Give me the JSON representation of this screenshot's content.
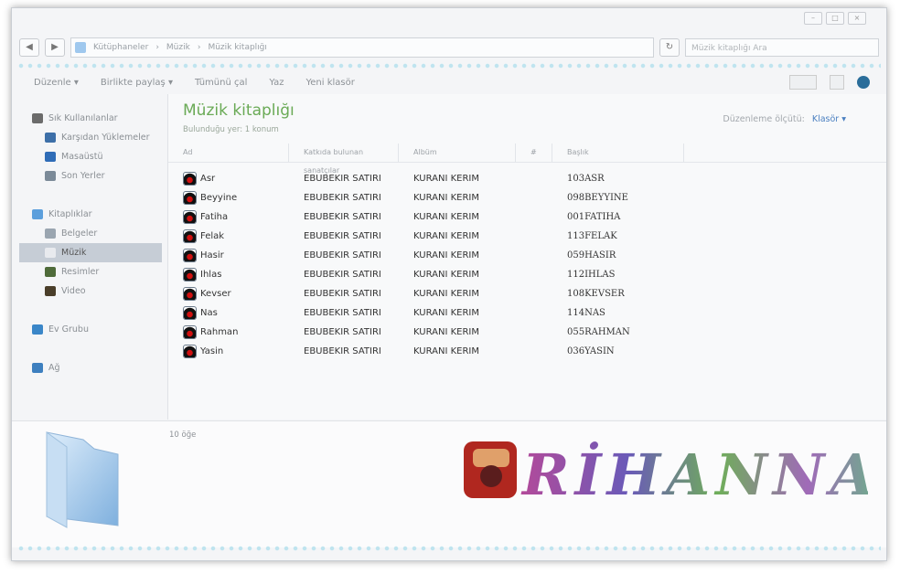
{
  "window": {
    "buttons": [
      "–",
      "□",
      "×"
    ]
  },
  "address": {
    "path": [
      "Kütüphaneler",
      "Müzik",
      "Müzik kitaplığı"
    ],
    "search_placeholder": "Müzik kitaplığı Ara"
  },
  "toolbar": {
    "items": [
      "Düzenle ▾",
      "Birlikte paylaş ▾",
      "Tümünü çal",
      "Yaz",
      "Yeni klasör"
    ]
  },
  "sidebar": {
    "favorites_label": "Sık Kullanılanlar",
    "favorites": [
      "Karşıdan Yüklemeler",
      "Masaüstü",
      "Son Yerler"
    ],
    "libraries_label": "Kitaplıklar",
    "libraries": [
      "Belgeler",
      "Müzik",
      "Resimler",
      "Video"
    ],
    "selected": "Müzik",
    "homegroup": "Ev Grubu",
    "network": "Ağ"
  },
  "library": {
    "title": "Müzik kitaplığı",
    "subtitle": "Bulunduğu yer: 1 konum",
    "arrange_label": "Düzenleme ölçütü:",
    "arrange_value": "Klasör ▾"
  },
  "columns": [
    "Ad",
    "Katkıda bulunan sanatçılar",
    "Albüm",
    "#",
    "Başlık"
  ],
  "files": [
    {
      "name": "Asr",
      "artist": "EBUBEKIR SATIRI",
      "album": "KURANI KERIM",
      "title": "103ASR"
    },
    {
      "name": "Beyyine",
      "artist": "EBUBEKIR SATIRI",
      "album": "KURANI KERIM",
      "title": "098BEYYINE"
    },
    {
      "name": "Fatiha",
      "artist": "EBUBEKIR SATIRI",
      "album": "KURANI KERIM",
      "title": "001FATIHA"
    },
    {
      "name": "Felak",
      "artist": "EBUBEKIR SATIRI",
      "album": "KURANI KERIM",
      "title": "113FELAK"
    },
    {
      "name": "Hasir",
      "artist": "EBUBEKIR SATIRI",
      "album": "KURANI KERIM",
      "title": "059HASIR"
    },
    {
      "name": "Ihlas",
      "artist": "EBUBEKIR SATIRI",
      "album": "KURANI KERIM",
      "title": "112IHLAS"
    },
    {
      "name": "Kevser",
      "artist": "EBUBEKIR SATIRI",
      "album": "KURANI KERIM",
      "title": "108KEVSER"
    },
    {
      "name": "Nas",
      "artist": "EBUBEKIR SATIRI",
      "album": "KURANI KERIM",
      "title": "114NAS"
    },
    {
      "name": "Rahman",
      "artist": "EBUBEKIR SATIRI",
      "album": "KURANI KERIM",
      "title": "055RAHMAN"
    },
    {
      "name": "Yasin",
      "artist": "EBUBEKIR SATIRI",
      "album": "KURANI KERIM",
      "title": "036YASIN"
    }
  ],
  "details": {
    "item_count": "10 öğe",
    "logo_text": "RİHANNA"
  },
  "colors": {
    "accent_green": "#6aaa56",
    "link_blue": "#4a7fc0",
    "wave": "#bfe4ef"
  }
}
